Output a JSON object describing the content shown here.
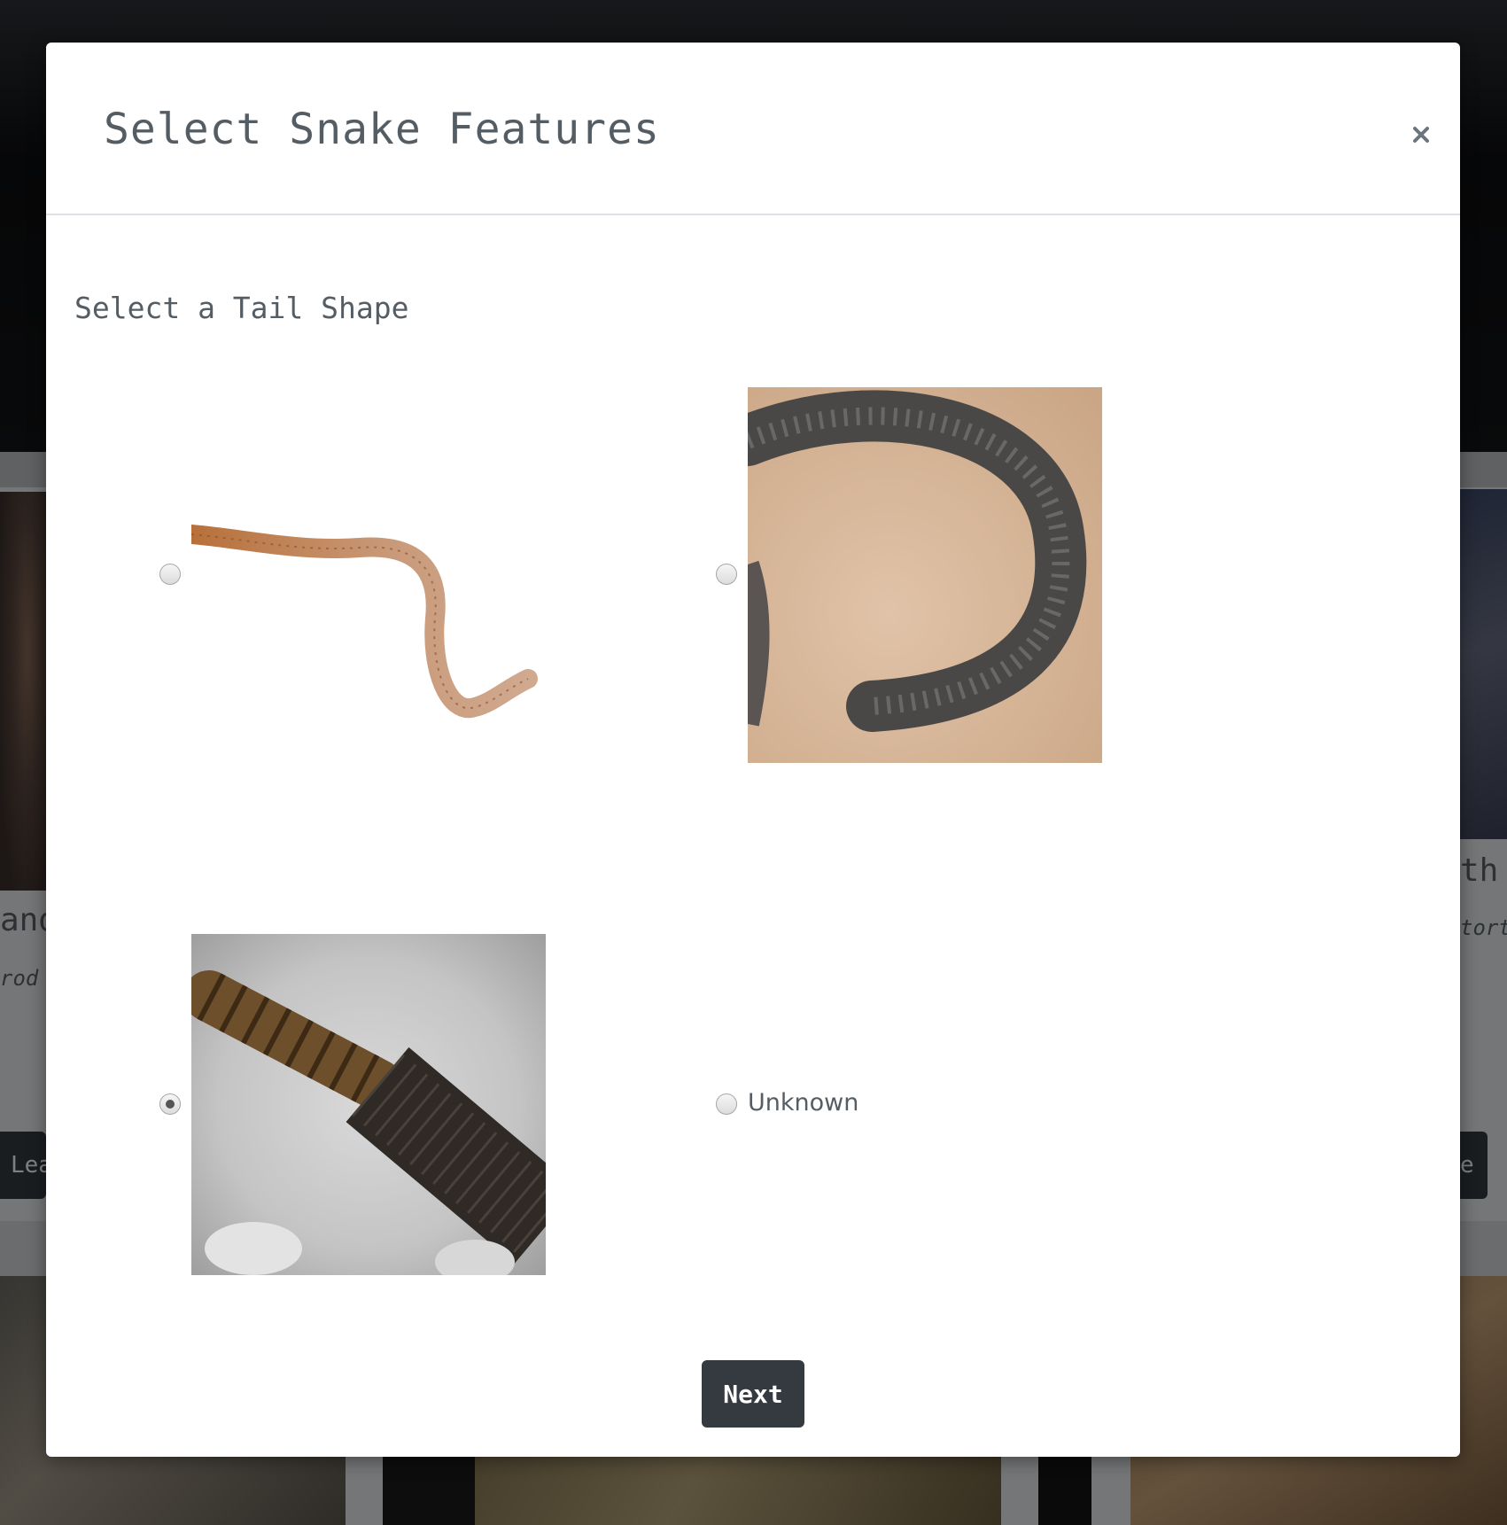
{
  "modal": {
    "title": "Select Snake Features",
    "close_label": "×",
    "step_title": "Select a Tail Shape",
    "next_label": "Next"
  },
  "options": [
    {
      "id": "tapering",
      "selected": false,
      "icon": "thin-tapering-tail-image"
    },
    {
      "id": "blunt",
      "selected": false,
      "icon": "short-blunt-tail-image"
    },
    {
      "id": "rattle",
      "selected": true,
      "icon": "rattle-tail-image"
    },
    {
      "id": "unknown",
      "label": "Unknown",
      "selected": false
    }
  ],
  "background": {
    "left_card_title": "and",
    "left_card_sub": "rod",
    "right_card_title": "th",
    "right_card_sub": "tort",
    "left_button": "Lea",
    "right_button": "e"
  },
  "colors": {
    "primary_dark": "#343a40",
    "text_muted": "#555d64",
    "divider": "#dee2e6"
  }
}
